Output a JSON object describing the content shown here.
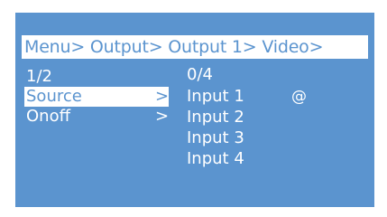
{
  "breadcrumb": "Menu> Output> Output 1> Video>",
  "left_menu": {
    "page": "1/2",
    "items": [
      {
        "label": "Source",
        "arrow": ">",
        "selected": true
      },
      {
        "label": "Onoff",
        "arrow": ">",
        "selected": false
      }
    ]
  },
  "right_menu": {
    "page": "0/4",
    "items": [
      "Input 1",
      "Input 2",
      "Input 3",
      "Input 4"
    ],
    "current_marker": "@"
  },
  "colors": {
    "background": "#5b94cf",
    "highlight": "#ffffff",
    "text": "#ffffff"
  }
}
